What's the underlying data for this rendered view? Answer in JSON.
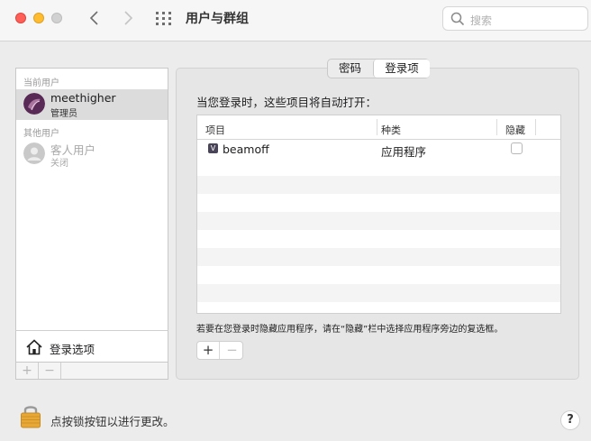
{
  "window": {
    "title": "用户与群组",
    "search_placeholder": "搜索"
  },
  "sidebar": {
    "current_user_label": "当前用户",
    "current_user": {
      "name": "meethigher",
      "role": "管理员"
    },
    "other_users_label": "其他用户",
    "guest_user": {
      "name": "客人用户",
      "status": "关闭"
    },
    "login_options_label": "登录选项",
    "add_label": "+",
    "remove_label": "−"
  },
  "tabs": [
    {
      "label": "密码",
      "selected": false
    },
    {
      "label": "登录项",
      "selected": true
    }
  ],
  "login_items": {
    "intro": "当您登录时，这些项目将自动打开：",
    "columns": {
      "item": "项目",
      "kind": "种类",
      "hide": "隐藏"
    },
    "rows": [
      {
        "name": "beamoff",
        "kind": "应用程序",
        "hidden": false,
        "icon": "beamoff-app-icon"
      }
    ],
    "hint": "若要在您登录时隐藏应用程序，请在“隐藏”栏中选择应用程序旁边的复选框。",
    "add_label": "+",
    "remove_label": "−"
  },
  "footer": {
    "lock_text": "点按锁按钮以进行更改。",
    "help_label": "?"
  },
  "colors": {
    "close": "#fe5f57",
    "minimize": "#febc2e",
    "zoom_disabled": "#d1d1d1",
    "selected_row": "#dcdcdc",
    "lock": "#e8a838"
  }
}
